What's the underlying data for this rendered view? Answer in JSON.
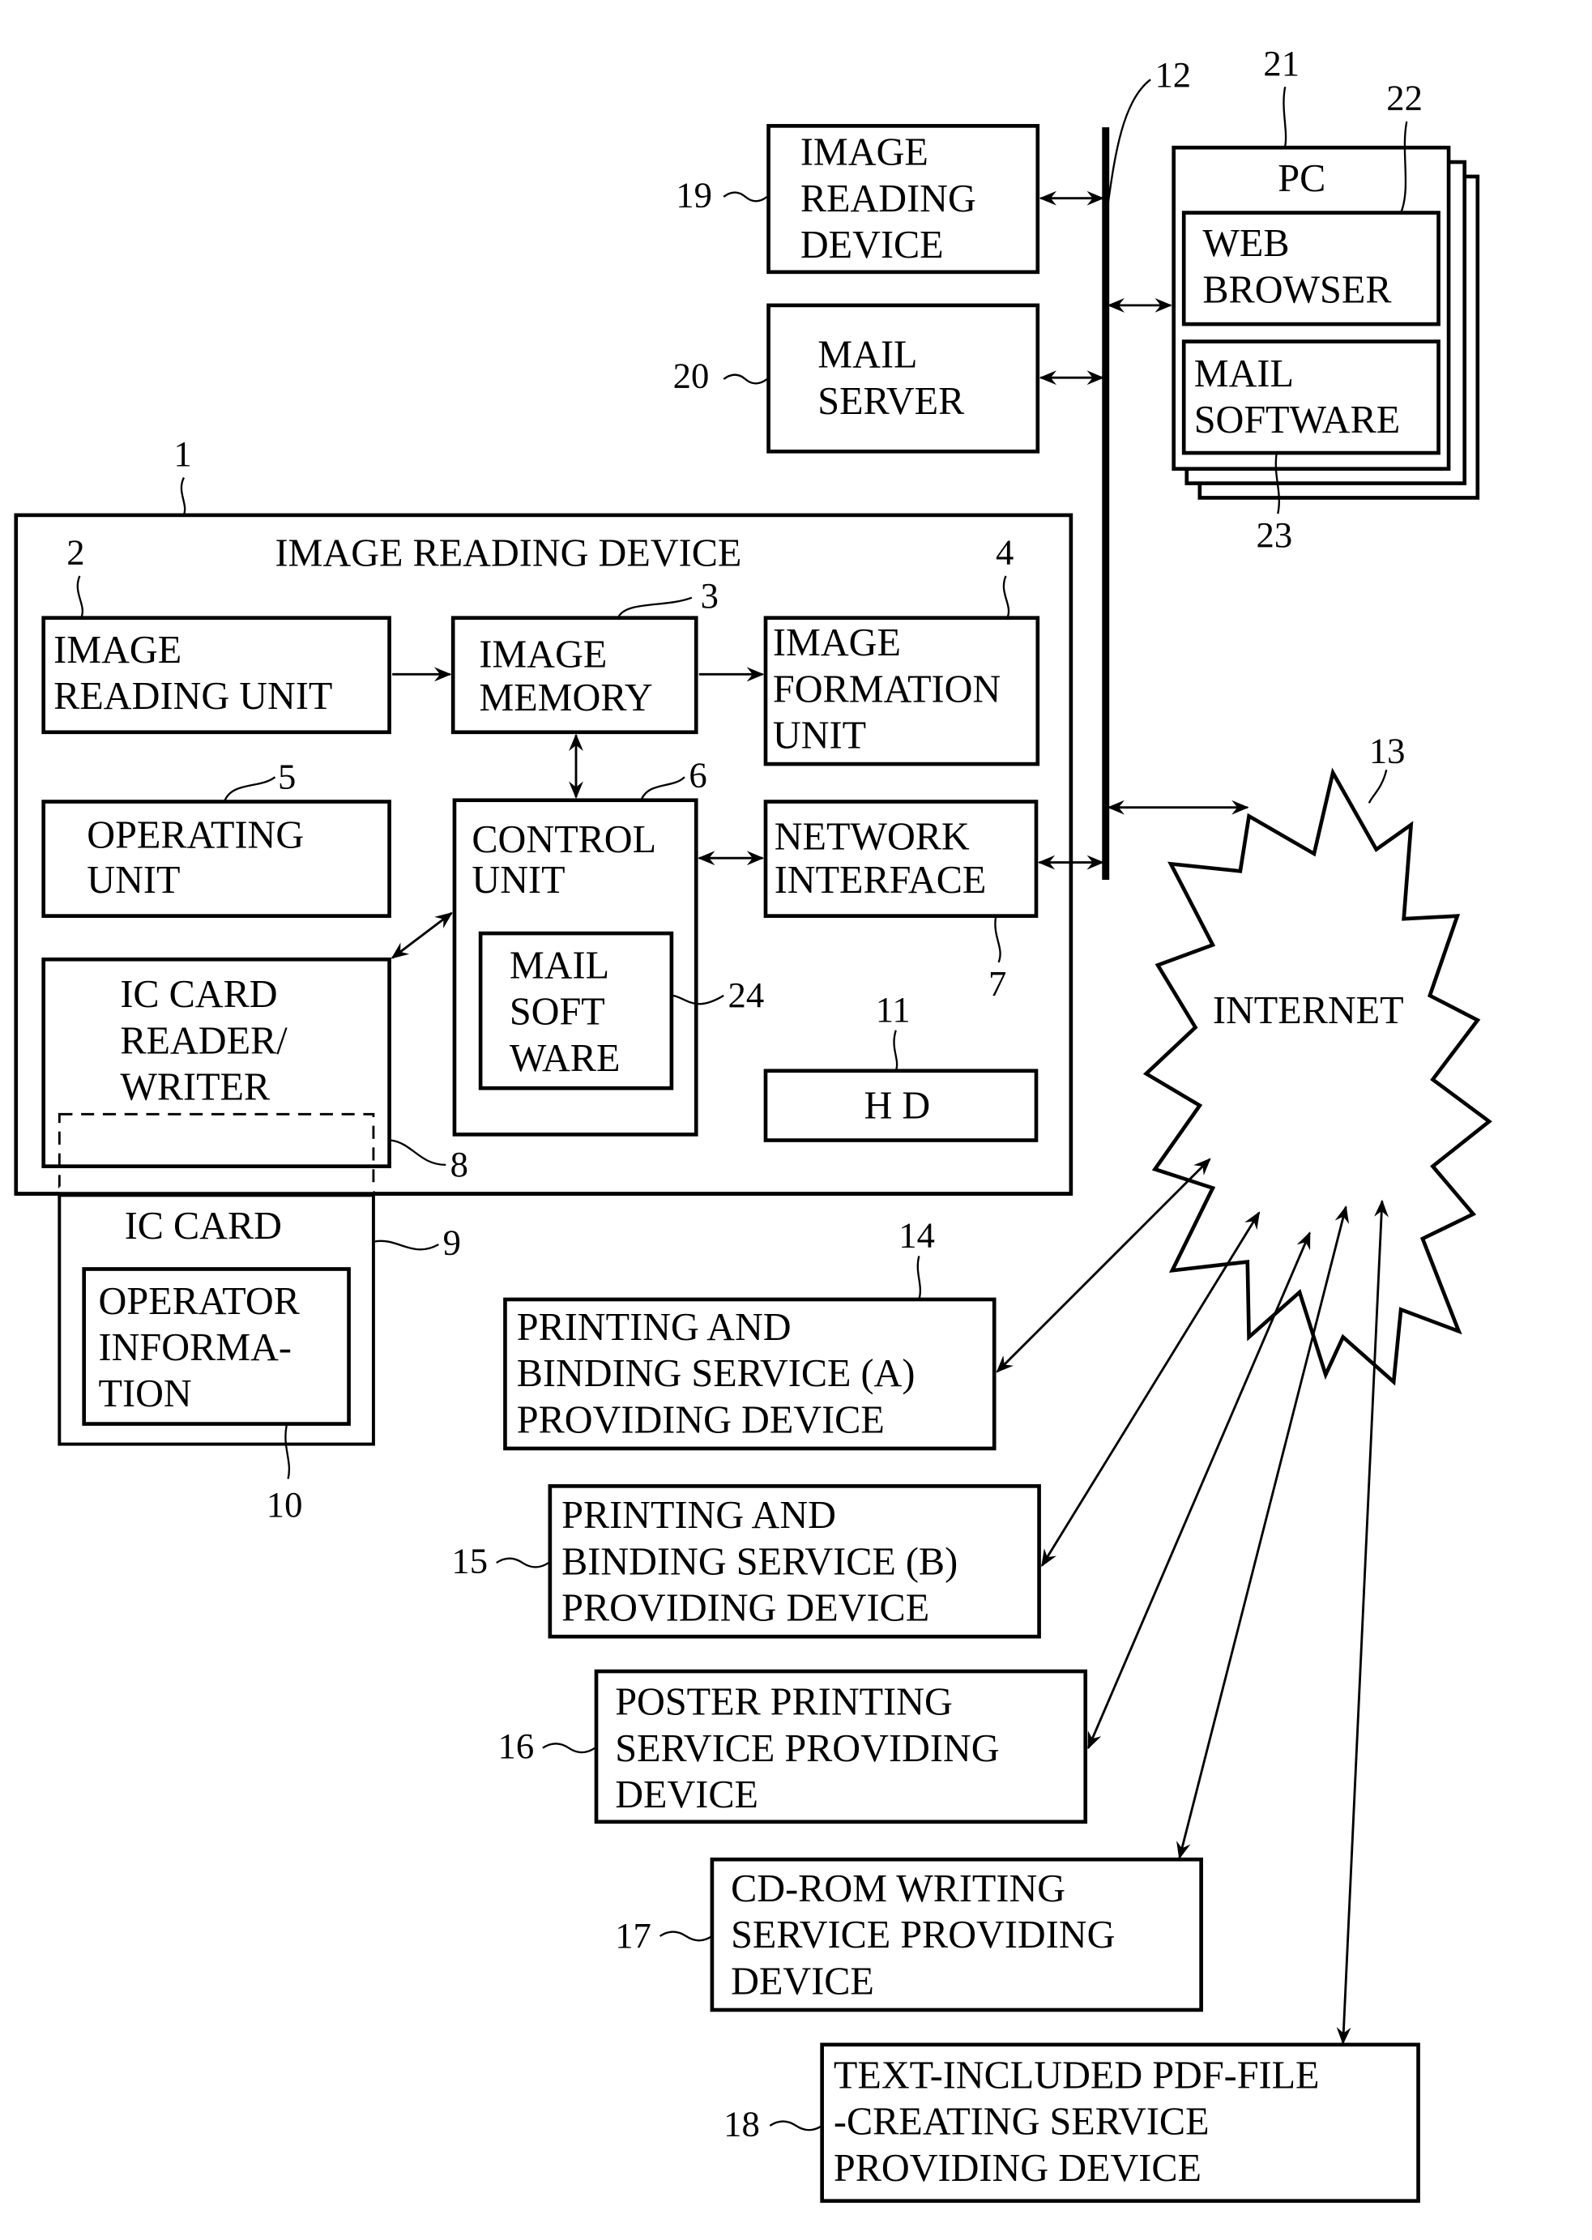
{
  "figure": {
    "network_bus_ref": "12",
    "blocks": {
      "image_reading_device_19": {
        "ref": "19",
        "lines": [
          "IMAGE",
          "READING",
          "DEVICE"
        ]
      },
      "mail_server": {
        "ref": "20",
        "lines": [
          "MAIL",
          "SERVER"
        ]
      },
      "pc": {
        "ref": "21",
        "title": "PC"
      },
      "web_browser": {
        "ref": "22",
        "lines": [
          "WEB",
          "BROWSER"
        ]
      },
      "pc_mail_software": {
        "ref": "23",
        "lines": [
          "MAIL",
          "SOFTWARE"
        ]
      },
      "image_reading_device_main": {
        "ref": "1",
        "title": "IMAGE READING DEVICE"
      },
      "image_reading_unit": {
        "ref": "2",
        "lines": [
          "IMAGE",
          "READING UNIT"
        ]
      },
      "image_memory": {
        "ref": "3",
        "lines": [
          "IMAGE",
          "MEMORY"
        ]
      },
      "image_formation_unit": {
        "ref": "4",
        "lines": [
          "IMAGE",
          "FORMATION",
          "UNIT"
        ]
      },
      "operating_unit": {
        "ref": "5",
        "lines": [
          "OPERATING",
          "UNIT"
        ]
      },
      "control_unit": {
        "ref": "6",
        "lines": [
          "CONTROL",
          "UNIT"
        ]
      },
      "network_interface": {
        "ref": "7",
        "lines": [
          "NETWORK",
          "INTERFACE"
        ]
      },
      "ic_card_reader_writer": {
        "ref": "8",
        "lines": [
          "IC CARD",
          "READER/",
          "WRITER"
        ]
      },
      "ic_card": {
        "ref": "9",
        "title": "IC CARD"
      },
      "operator_information": {
        "ref": "10",
        "lines": [
          "OPERATOR",
          "INFORMA-",
          "TION"
        ]
      },
      "hd": {
        "ref": "11",
        "label": "H D"
      },
      "control_mail_software": {
        "ref": "24",
        "lines": [
          "MAIL",
          "SOFT",
          "WARE"
        ]
      },
      "internet": {
        "ref": "13",
        "label": "INTERNET"
      },
      "service_a": {
        "ref": "14",
        "lines": [
          "PRINTING AND",
          "BINDING SERVICE (A)",
          "PROVIDING DEVICE"
        ]
      },
      "service_b": {
        "ref": "15",
        "lines": [
          "PRINTING AND",
          "BINDING SERVICE (B)",
          "PROVIDING DEVICE"
        ]
      },
      "poster_service": {
        "ref": "16",
        "lines": [
          "POSTER PRINTING",
          "SERVICE PROVIDING",
          "DEVICE"
        ]
      },
      "cdrom_service": {
        "ref": "17",
        "lines": [
          "CD-ROM WRITING",
          "SERVICE PROVIDING",
          "DEVICE"
        ]
      },
      "pdf_service": {
        "ref": "18",
        "lines": [
          "TEXT-INCLUDED PDF-FILE",
          "-CREATING SERVICE",
          "PROVIDING DEVICE"
        ]
      }
    }
  }
}
